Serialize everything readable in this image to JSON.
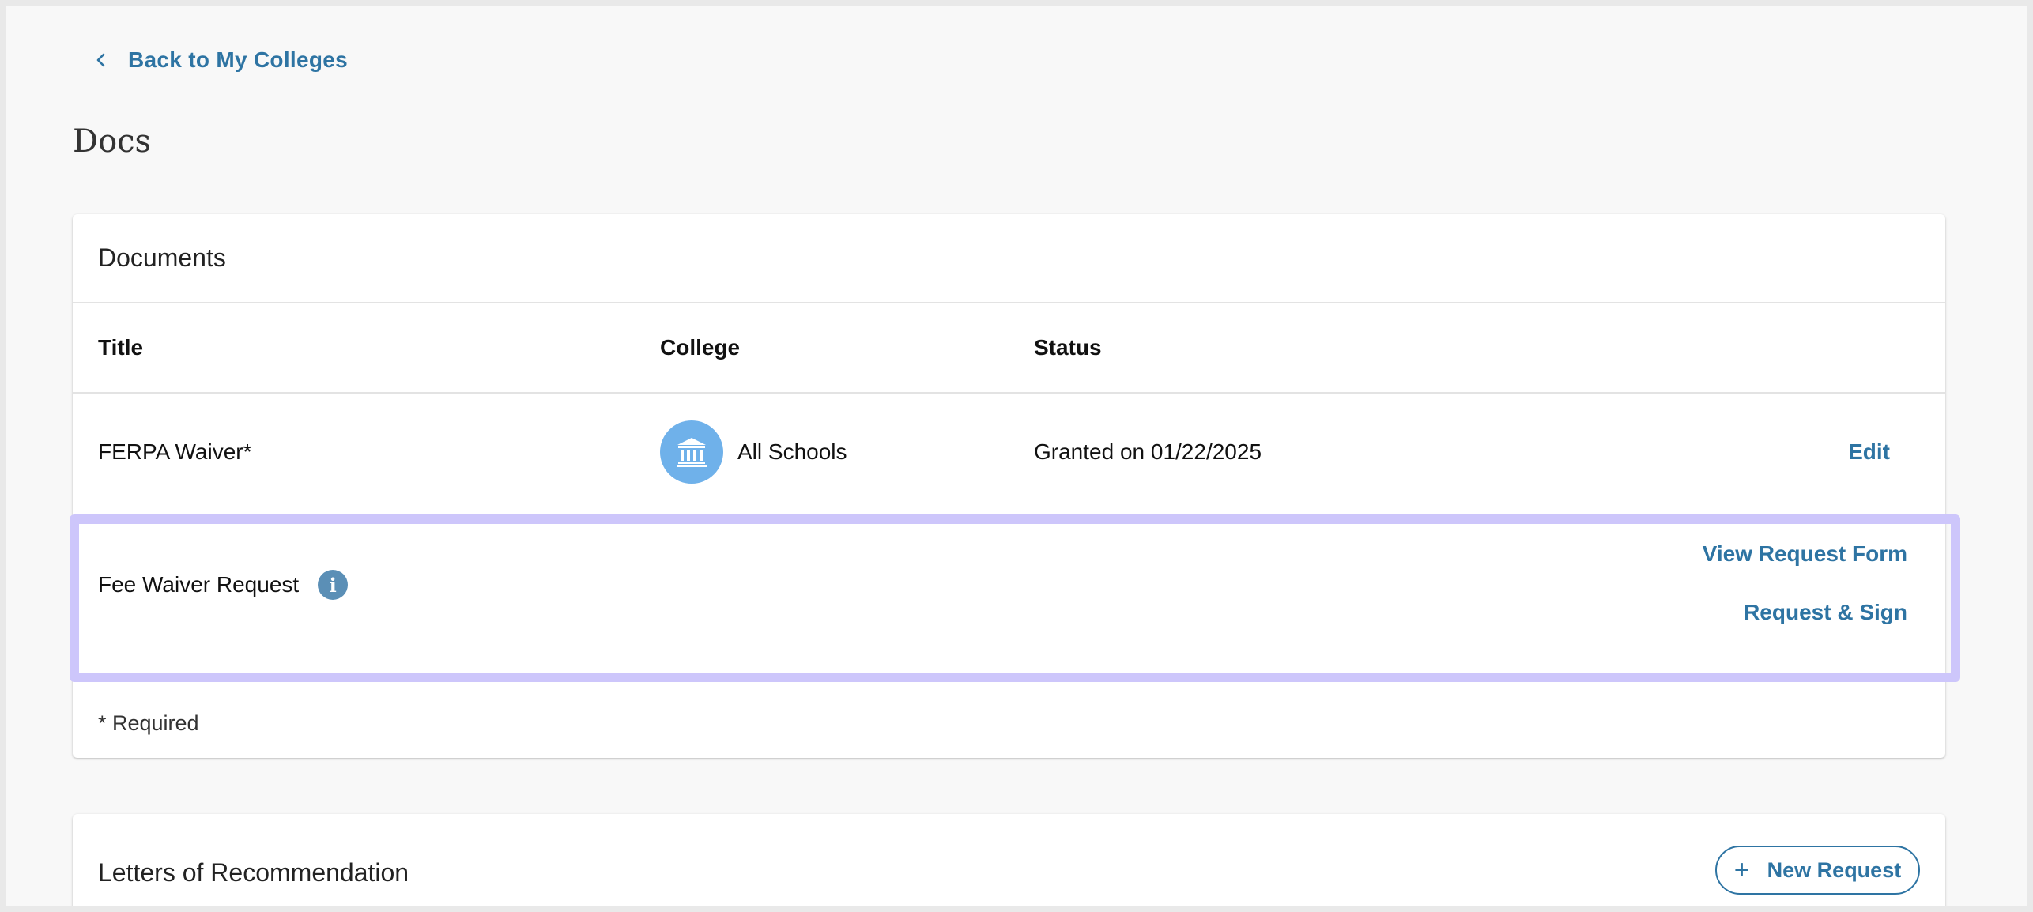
{
  "nav": {
    "back_label": "Back to My Colleges"
  },
  "page": {
    "title": "Docs"
  },
  "documents": {
    "header": "Documents",
    "columns": {
      "title": "Title",
      "college": "College",
      "status": "Status"
    },
    "rows": [
      {
        "title": "FERPA Waiver*",
        "college": "All Schools",
        "status": "Granted on 01/22/2025",
        "action": "Edit"
      }
    ],
    "fee_waiver": {
      "title": "Fee Waiver Request",
      "info_icon_glyph": "i",
      "view_form_label": "View Request Form",
      "request_sign_label": "Request & Sign"
    },
    "required_note": "* Required"
  },
  "letters": {
    "header": "Letters of Recommendation",
    "new_request_label": "New Request",
    "new_request_icon": "+"
  },
  "colors": {
    "accent": "#2e74a3",
    "highlight": "#cdc6fb",
    "college_avatar": "#6fb1ea",
    "info_icon": "#5b8fb6"
  }
}
